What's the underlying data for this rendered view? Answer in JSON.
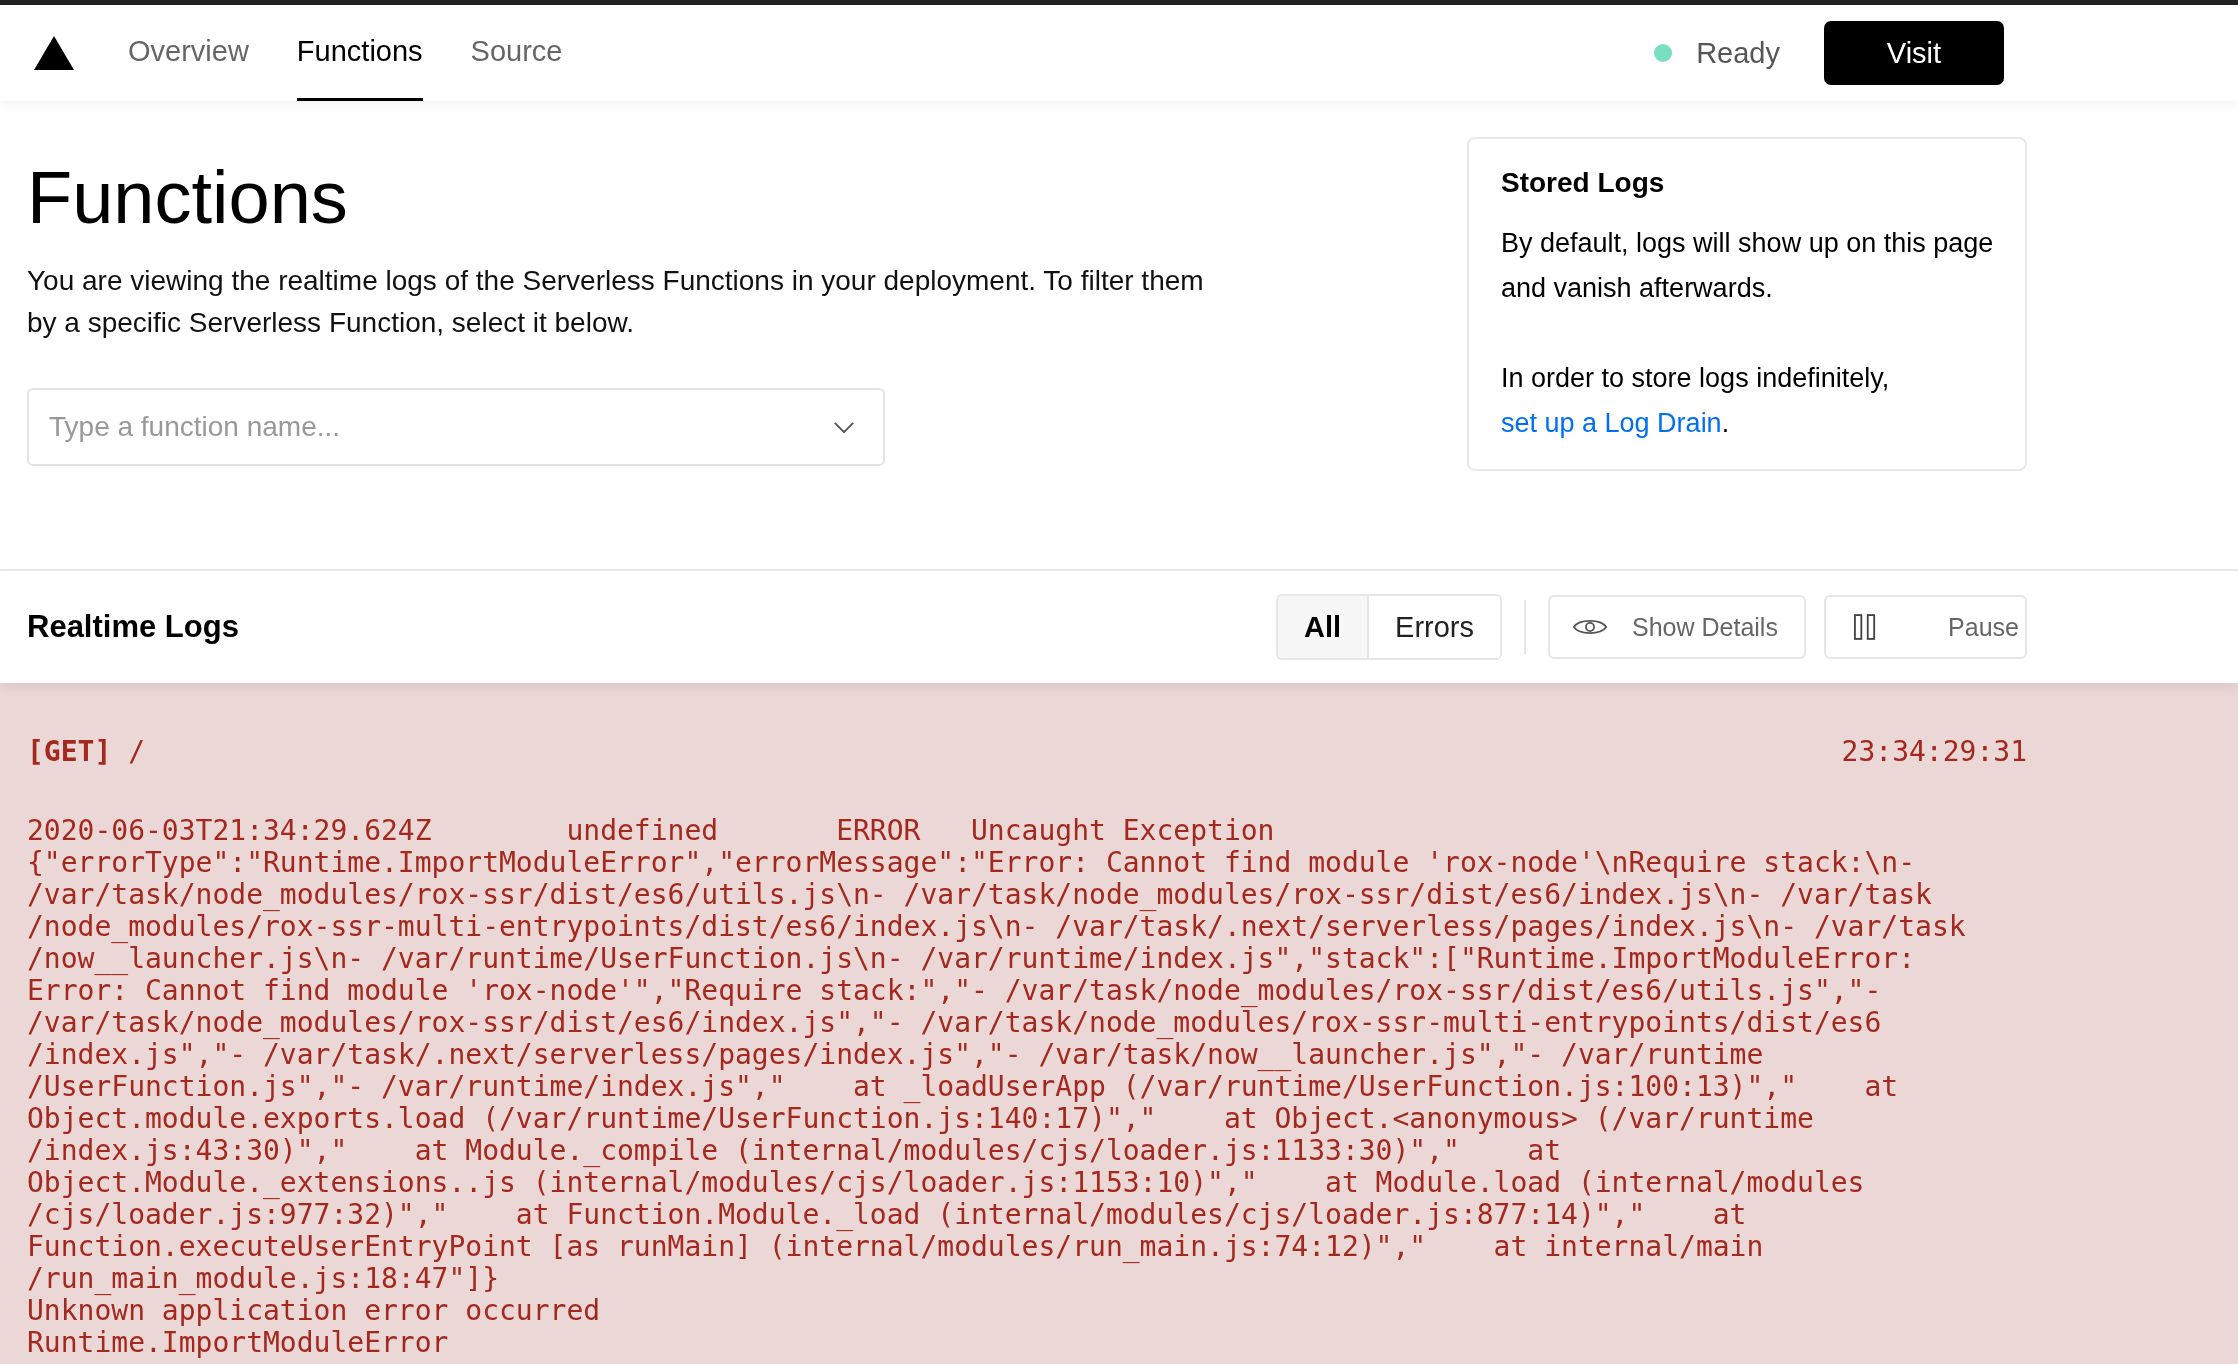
{
  "nav": {
    "tabs": [
      {
        "label": "Overview",
        "selected": false
      },
      {
        "label": "Functions",
        "selected": true
      },
      {
        "label": "Source",
        "selected": false
      }
    ],
    "status": {
      "label": "Ready",
      "color": "#79dfc1"
    },
    "visit_button": "Visit"
  },
  "page": {
    "title": "Functions",
    "description": "You are viewing the realtime logs of the Serverless Functions in your deployment. To filter them by a specific Serverless Function, select it below.",
    "function_select": {
      "placeholder": "Type a function name..."
    }
  },
  "stored_logs": {
    "title": "Stored Logs",
    "text": "By default, logs will show up on this page and vanish afterwards.",
    "text_2": "In order to store logs indefinitely, ",
    "link": "set up a Log Drain",
    "text_end": "."
  },
  "realtime_logs": {
    "title": "Realtime Logs",
    "filters": [
      {
        "label": "All",
        "selected": true
      },
      {
        "label": "Errors",
        "selected": false
      }
    ],
    "show_details": "Show Details",
    "pause": "Pause",
    "entry": {
      "request": "**[GET]** /",
      "time": "23:34:29:31",
      "lines": [
        "2020-06-03T21:34:29.624Z        undefined       ERROR   Uncaught Exception",
        "{\"errorType\":\"Runtime.ImportModuleError\",\"errorMessage\":\"Error: Cannot find module 'rox-node'\\nRequire stack:\\n-",
        "/var/task/node_modules/rox-ssr/dist/es6/utils.js\\n- /var/task/node_modules/rox-ssr/dist/es6/index.js\\n- /var/task",
        "/node_modules/rox-ssr-multi-entrypoints/dist/es6/index.js\\n- /var/task/.next/serverless/pages/index.js\\n- /var/task",
        "/now__launcher.js\\n- /var/runtime/UserFunction.js\\n- /var/runtime/index.js\",\"stack\":[\"Runtime.ImportModuleError:",
        "Error: Cannot find module 'rox-node'\",\"Require stack:\",\"- /var/task/node_modules/rox-ssr/dist/es6/utils.js\",\"-",
        "/var/task/node_modules/rox-ssr/dist/es6/index.js\",\"- /var/task/node_modules/rox-ssr-multi-entrypoints/dist/es6",
        "/index.js\",\"- /var/task/.next/serverless/pages/index.js\",\"- /var/task/now__launcher.js\",\"- /var/runtime",
        "/UserFunction.js\",\"- /var/runtime/index.js\",\"    at _loadUserApp (/var/runtime/UserFunction.js:100:13)\",\"    at",
        "Object.module.exports.load (/var/runtime/UserFunction.js:140:17)\",\"    at Object.<anonymous> (/var/runtime",
        "/index.js:43:30)\",\"    at Module._compile (internal/modules/cjs/loader.js:1133:30)\",\"    at",
        "Object.Module._extensions..js (internal/modules/cjs/loader.js:1153:10)\",\"    at Module.load (internal/modules",
        "/cjs/loader.js:977:32)\",\"    at Function.Module._load (internal/modules/cjs/loader.js:877:14)\",\"    at",
        "Function.executeUserEntryPoint [as runMain] (internal/modules/run_main.js:74:12)\",\"    at internal/main",
        "/run_main_module.js:18:47\"]}",
        "Unknown application error occurred",
        "Runtime.ImportModuleError"
      ]
    }
  }
}
